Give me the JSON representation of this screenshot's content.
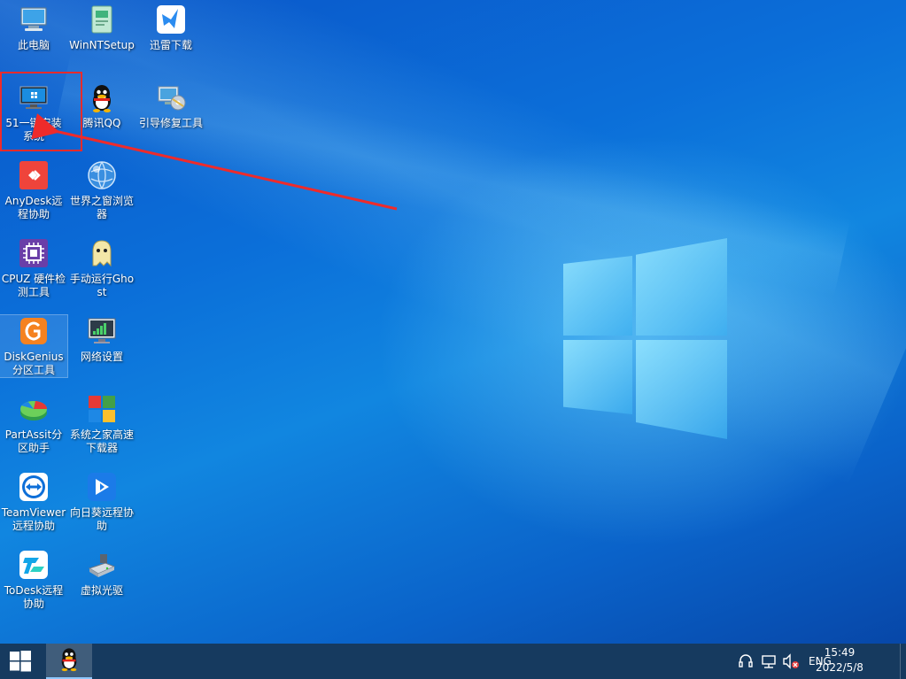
{
  "desktop": {
    "icons": [
      {
        "label": "此电脑",
        "icon": "computer-icon"
      },
      {
        "label": "WinNTSetup",
        "icon": "winntsetup-icon"
      },
      {
        "label": "迅雷下载",
        "icon": "thunder-icon"
      },
      {
        "label": "51一键安装系统",
        "icon": "install-system-icon"
      },
      {
        "label": "腾讯QQ",
        "icon": "qq-icon"
      },
      {
        "label": "引导修复工具",
        "icon": "boot-repair-icon"
      },
      {
        "label": "AnyDesk远程协助",
        "icon": "anydesk-icon"
      },
      {
        "label": "世界之窗浏览器",
        "icon": "browser-icon"
      },
      {
        "label": "CPUZ 硬件检测工具",
        "icon": "cpuz-icon"
      },
      {
        "label": "手动运行Ghost",
        "icon": "ghost-icon"
      },
      {
        "label": "DiskGenius分区工具",
        "icon": "diskgenius-icon"
      },
      {
        "label": "网络设置",
        "icon": "network-settings-icon"
      },
      {
        "label": "PartAssit分区助手",
        "icon": "partassist-icon"
      },
      {
        "label": "系统之家高速下载器",
        "icon": "downloader-icon"
      },
      {
        "label": "TeamViewer远程协助",
        "icon": "teamviewer-icon"
      },
      {
        "label": "向日葵远程协助",
        "icon": "sunlogin-icon"
      },
      {
        "label": "ToDesk远程协助",
        "icon": "todesk-icon"
      },
      {
        "label": "虚拟光驱",
        "icon": "virtual-drive-icon"
      }
    ]
  },
  "taskbar": {
    "start_icon": "windows-start-icon",
    "pinned_app_icon": "qq-icon",
    "tray": {
      "icons": [
        "headset-icon",
        "network-icon",
        "volume-muted-icon"
      ],
      "language": "ENG",
      "time": "15:49",
      "date": "2022/5/8"
    }
  },
  "colors": {
    "highlight": "#ee2b2b",
    "taskbar": "#163a5f",
    "desktop_blue": "#0b6fd9"
  }
}
